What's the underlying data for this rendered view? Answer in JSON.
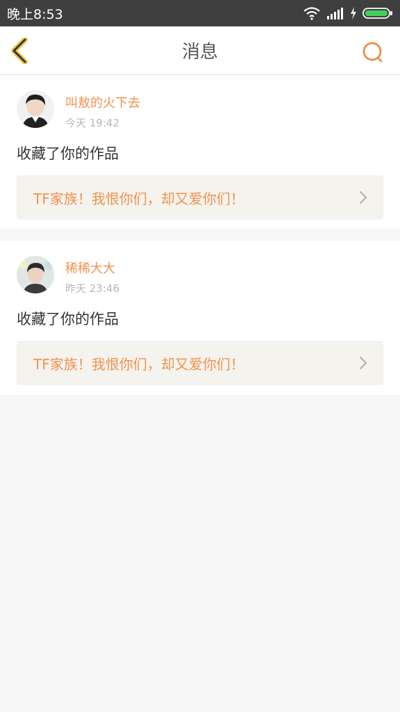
{
  "status_bar": {
    "time": "晚上8:53",
    "icons": [
      "wifi-icon",
      "signal-icon",
      "charging-icon",
      "battery-icon"
    ]
  },
  "header": {
    "title": "消息",
    "back_icon": "chevron-left-icon",
    "search_icon": "search-icon"
  },
  "messages": [
    {
      "username": "叫敖的火下去",
      "time": "今天 19:42",
      "action": "收藏了你的作品",
      "work_title": "TF家族！我恨你们，却又爱你们！"
    },
    {
      "username": "稀稀大大",
      "time": "昨天 23:46",
      "action": "收藏了你的作品",
      "work_title": "TF家族！我恨你们，却又爱你们！"
    }
  ],
  "colors": {
    "accent": "#f0924c",
    "status_bar": "#3f3f3f",
    "background": "#f6f6f6",
    "work_card_bg": "#f4f3ee"
  }
}
